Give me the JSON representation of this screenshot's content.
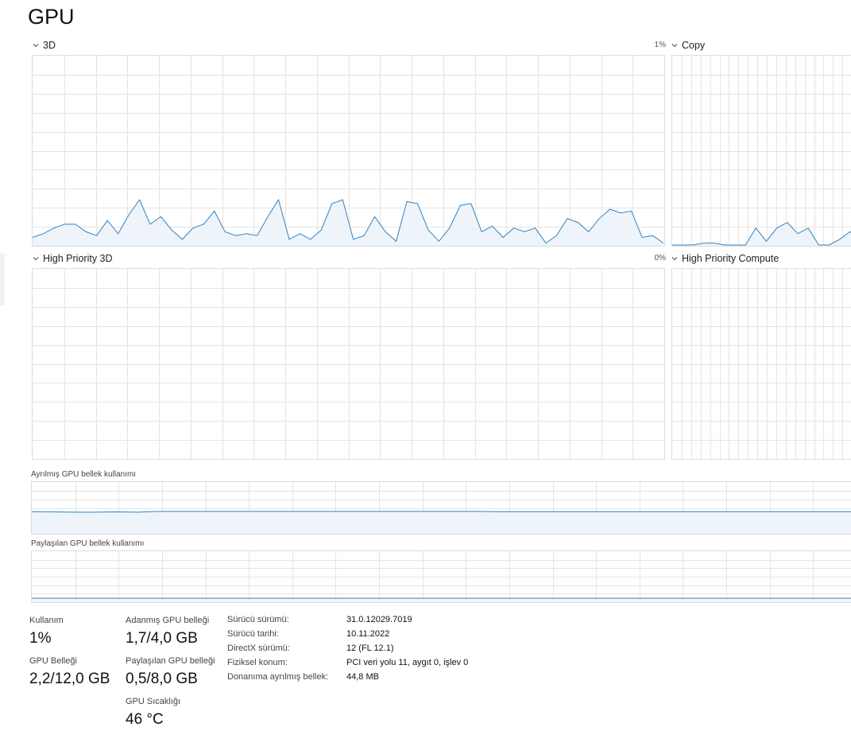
{
  "page": {
    "title": "GPU"
  },
  "engines": {
    "threeD": {
      "label": "3D",
      "percent": "1%"
    },
    "copy": {
      "label": "Copy"
    },
    "hp3d": {
      "label": "High Priority 3D",
      "percent": "0%"
    },
    "hpCompute": {
      "label": "High Priority Compute"
    }
  },
  "memory_graphs": {
    "dedicated": {
      "label": "Ayrılmış GPU bellek kullanımı"
    },
    "shared": {
      "label": "Paylaşılan GPU bellek kullanımı"
    }
  },
  "stats": {
    "usage": {
      "label": "Kullanım",
      "value": "1%"
    },
    "gpu_memory": {
      "label": "GPU Belleği",
      "value": "2,2/12,0 GB"
    },
    "dedicated": {
      "label": "Adanmış GPU belleği",
      "value": "1,7/4,0 GB"
    },
    "shared": {
      "label": "Paylaşılan GPU belleği",
      "value": "0,5/8,0 GB"
    },
    "temperature": {
      "label": "GPU Sıcaklığı",
      "value": "46 °C"
    }
  },
  "info": [
    {
      "key": "Sürücü sürümü:",
      "value": "31.0.12029.7019"
    },
    {
      "key": "Sürücü tarihi:",
      "value": "10.11.2022"
    },
    {
      "key": "DirectX sürümü:",
      "value": "12 (FL 12.1)"
    },
    {
      "key": "Fiziksel konum:",
      "value": "PCI veri yolu 11, aygıt 0, işlev 0"
    },
    {
      "key": "Donanıma ayrılmış bellek:",
      "value": "44,8 MB"
    }
  ],
  "colors": {
    "line": "#2f83c4",
    "fill": "#eef4fa",
    "grid": "#e4e4e4",
    "border": "#dcdcdc"
  },
  "icons": {
    "collapse": "chevron-down-icon"
  },
  "chart_data": [
    {
      "name": "3D",
      "type": "area",
      "ylim": [
        0,
        100
      ],
      "values": [
        4,
        6,
        9,
        11,
        11,
        7,
        5,
        13,
        6,
        16,
        24,
        11,
        15,
        8,
        3,
        9,
        11,
        18,
        7,
        5,
        6,
        5,
        15,
        24,
        3,
        6,
        3,
        8,
        22,
        24,
        3,
        5,
        15,
        7,
        2,
        23,
        22,
        8,
        2,
        9,
        21,
        22,
        7,
        10,
        4,
        9,
        7,
        9,
        1,
        5,
        14,
        12,
        7,
        14,
        19,
        17,
        18,
        4,
        5,
        1
      ],
      "grid": true
    },
    {
      "name": "Copy",
      "type": "area",
      "ylim": [
        0,
        100
      ],
      "values": [
        0,
        0,
        0,
        1,
        1,
        0,
        0,
        0,
        9,
        2,
        9,
        12,
        6,
        9,
        0,
        0,
        3,
        7,
        4
      ],
      "grid": true
    },
    {
      "name": "High Priority 3D",
      "type": "area",
      "ylim": [
        0,
        100
      ],
      "values": [],
      "grid": true
    },
    {
      "name": "High Priority Compute",
      "type": "area",
      "ylim": [
        0,
        100
      ],
      "values": [],
      "grid": true
    },
    {
      "name": "Ayrılmış GPU bellek kullanımı",
      "type": "area",
      "ylim": [
        0,
        4
      ],
      "values": [
        1.7,
        1.68,
        1.66,
        1.66,
        1.68,
        1.66,
        1.72,
        1.72,
        1.72,
        1.72,
        1.72,
        1.72,
        1.72,
        1.72,
        1.72,
        1.72,
        1.72,
        1.72,
        1.72,
        1.72,
        1.72,
        1.72,
        1.7,
        1.7,
        1.7,
        1.7,
        1.7,
        1.7,
        1.7,
        1.7,
        1.7,
        1.7,
        1.7,
        1.7,
        1.7,
        1.7,
        1.7,
        1.7,
        1.7,
        1.7
      ],
      "grid": true
    },
    {
      "name": "Paylaşılan GPU bellek kullanımı",
      "type": "area",
      "ylim": [
        0,
        8
      ],
      "values": [
        0.5,
        0.5,
        0.5,
        0.5,
        0.5,
        0.5,
        0.5,
        0.5,
        0.5,
        0.5,
        0.5,
        0.5,
        0.5,
        0.5,
        0.5,
        0.5,
        0.5,
        0.5,
        0.5,
        0.5
      ],
      "grid": true
    }
  ]
}
